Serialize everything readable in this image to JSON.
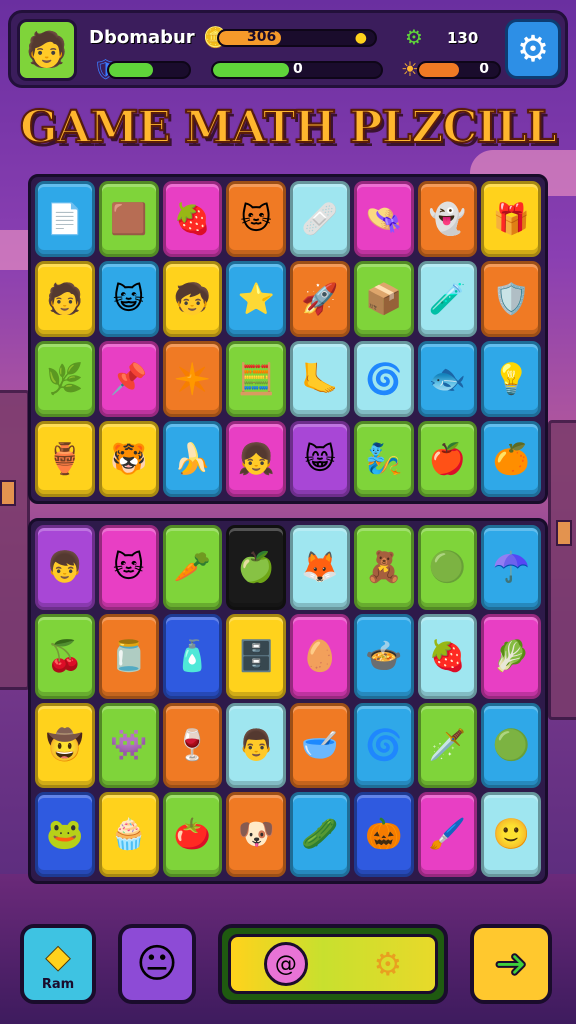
{
  "hud": {
    "player_name": "Dbomabur",
    "avatar_icon": "boy-face",
    "coins_value": "306",
    "score_value": "0",
    "gems_value": "130",
    "bonus_value": "0",
    "energy_fill": 0.55,
    "xp_fill": 0.45,
    "coins_fill": 0.4,
    "bonus_fill": 0.5
  },
  "title": "GAME MATH PLZCILL",
  "board_top": [
    {
      "icon": "📄",
      "color": "#2fa8e8",
      "name": "document"
    },
    {
      "icon": "🟫",
      "color": "#7fd43a",
      "name": "box"
    },
    {
      "icon": "🍓",
      "color": "#e83fc4",
      "name": "berry"
    },
    {
      "icon": "🐱",
      "color": "#f07a24",
      "name": "cat"
    },
    {
      "icon": "🩹",
      "color": "#9fe6f0",
      "name": "bandage"
    },
    {
      "icon": "👒",
      "color": "#e83fc4",
      "name": "hat-face"
    },
    {
      "icon": "👻",
      "color": "#f07a24",
      "name": "ghost"
    },
    {
      "icon": "🎁",
      "color": "#ffd21c",
      "name": "gift"
    },
    {
      "icon": "🧑",
      "color": "#ffd21c",
      "name": "chef-face"
    },
    {
      "icon": "😺",
      "color": "#2fa8e8",
      "name": "pink-cat"
    },
    {
      "icon": "🧒",
      "color": "#ffd21c",
      "name": "cap-face"
    },
    {
      "icon": "⭐",
      "color": "#2fa8e8",
      "name": "star"
    },
    {
      "icon": "🚀",
      "color": "#f07a24",
      "name": "rocket"
    },
    {
      "icon": "📦",
      "color": "#7fd43a",
      "name": "crate"
    },
    {
      "icon": "🧪",
      "color": "#9fe6f0",
      "name": "test-tube"
    },
    {
      "icon": "🛡️",
      "color": "#f07a24",
      "name": "shield"
    },
    {
      "icon": "🌿",
      "color": "#7fd43a",
      "name": "sprout"
    },
    {
      "icon": "📌",
      "color": "#e83fc4",
      "name": "pin"
    },
    {
      "icon": "✴️",
      "color": "#f07a24",
      "name": "burst"
    },
    {
      "icon": "🧮",
      "color": "#7fd43a",
      "name": "calculator"
    },
    {
      "icon": "🦶",
      "color": "#9fe6f0",
      "name": "foot"
    },
    {
      "icon": "🌀",
      "color": "#9fe6f0",
      "name": "spiral"
    },
    {
      "icon": "🐟",
      "color": "#2fa8e8",
      "name": "fish"
    },
    {
      "icon": "💡",
      "color": "#2fa8e8",
      "name": "bulb"
    },
    {
      "icon": "🏺",
      "color": "#ffd21c",
      "name": "vase"
    },
    {
      "icon": "🐯",
      "color": "#ffd21c",
      "name": "tiger"
    },
    {
      "icon": "🍌",
      "color": "#2fa8e8",
      "name": "banana"
    },
    {
      "icon": "👧",
      "color": "#e83fc4",
      "name": "girl-face"
    },
    {
      "icon": "😸",
      "color": "#a847d6",
      "name": "purple-cat"
    },
    {
      "icon": "🧞",
      "color": "#7fd43a",
      "name": "genie"
    },
    {
      "icon": "🍎",
      "color": "#7fd43a",
      "name": "apple"
    },
    {
      "icon": "🍊",
      "color": "#2fa8e8",
      "name": "orange"
    }
  ],
  "board_bottom": [
    {
      "icon": "👦",
      "color": "#a847d6",
      "name": "boy"
    },
    {
      "icon": "🐱",
      "color": "#e83fc4",
      "name": "cat-girl"
    },
    {
      "icon": "🥕",
      "color": "#7fd43a",
      "name": "carrot"
    },
    {
      "icon": "🍏",
      "color": "#1a1a1a",
      "name": "green-apple"
    },
    {
      "icon": "🦊",
      "color": "#9fe6f0",
      "name": "fox"
    },
    {
      "icon": "🧸",
      "color": "#7fd43a",
      "name": "doll"
    },
    {
      "icon": "🟢",
      "color": "#7fd43a",
      "name": "green-blob"
    },
    {
      "icon": "☂️",
      "color": "#2fa8e8",
      "name": "umbrella"
    },
    {
      "icon": "🍒",
      "color": "#7fd43a",
      "name": "cherry"
    },
    {
      "icon": "🫙",
      "color": "#f07a24",
      "name": "jar"
    },
    {
      "icon": "🧴",
      "color": "#2f5ae0",
      "name": "bottle"
    },
    {
      "icon": "🗄️",
      "color": "#ffd21c",
      "name": "cabinet"
    },
    {
      "icon": "🥚",
      "color": "#e83fc4",
      "name": "egg-face"
    },
    {
      "icon": "🍲",
      "color": "#2fa8e8",
      "name": "bowl"
    },
    {
      "icon": "🍓",
      "color": "#9fe6f0",
      "name": "strawberry"
    },
    {
      "icon": "🥬",
      "color": "#e83fc4",
      "name": "lettuce"
    },
    {
      "icon": "🤠",
      "color": "#ffd21c",
      "name": "cowboy"
    },
    {
      "icon": "👾",
      "color": "#7fd43a",
      "name": "monster"
    },
    {
      "icon": "🍷",
      "color": "#f07a24",
      "name": "glass"
    },
    {
      "icon": "👨",
      "color": "#9fe6f0",
      "name": "man"
    },
    {
      "icon": "🥣",
      "color": "#f07a24",
      "name": "cup"
    },
    {
      "icon": "🌀",
      "color": "#2fa8e8",
      "name": "swirl"
    },
    {
      "icon": "🗡️",
      "color": "#7fd43a",
      "name": "dagger"
    },
    {
      "icon": "🟢",
      "color": "#2fa8e8",
      "name": "lime"
    },
    {
      "icon": "🐸",
      "color": "#2f5ae0",
      "name": "frog"
    },
    {
      "icon": "🧁",
      "color": "#ffd21c",
      "name": "cupcake"
    },
    {
      "icon": "🍅",
      "color": "#7fd43a",
      "name": "tomato"
    },
    {
      "icon": "🐶",
      "color": "#f07a24",
      "name": "dog"
    },
    {
      "icon": "🥒",
      "color": "#2fa8e8",
      "name": "cucumber"
    },
    {
      "icon": "🎃",
      "color": "#2f5ae0",
      "name": "pumpkin"
    },
    {
      "icon": "🖌️",
      "color": "#e83fc4",
      "name": "brush"
    },
    {
      "icon": "🙂",
      "color": "#9fe6f0",
      "name": "smile"
    }
  ],
  "controls": {
    "hint_label": "Ram",
    "hint_icon": "diamond-star",
    "face_icon": "face",
    "main_icons": [
      "flower-swirl",
      "gear-search"
    ],
    "next_icon": "arrow-right"
  }
}
